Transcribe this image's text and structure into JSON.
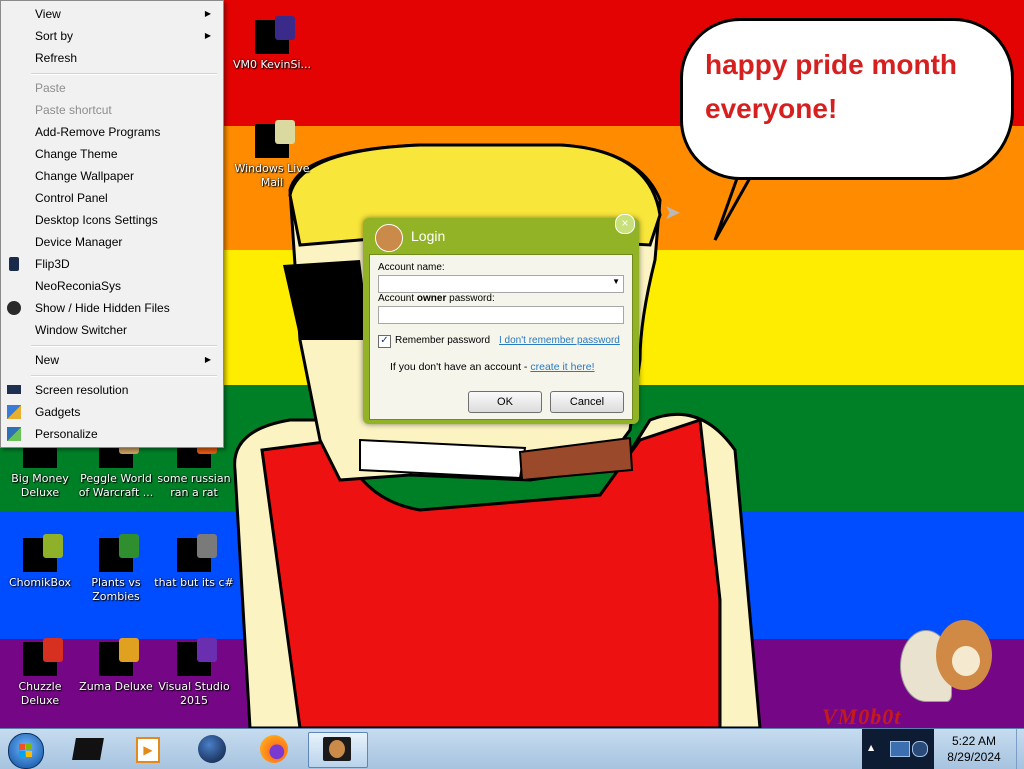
{
  "desktop": {
    "stripe_colors": [
      "#e40303",
      "#ff8c00",
      "#ffed00",
      "#008026",
      "#004dff",
      "#750787"
    ],
    "speech_bubble": "happy pride month everyone!",
    "watermark": "VM0b0t",
    "icons": [
      {
        "label": "VM0 KevinSi...",
        "icon": "video-file-icon"
      },
      {
        "label": "Windows Live Mail",
        "icon": "mail-icon"
      },
      {
        "label": "Big Money Deluxe",
        "icon": "game-icon"
      },
      {
        "label": "Peggle World of Warcraft ...",
        "icon": "game-icon"
      },
      {
        "label": "some russian ran a rat",
        "icon": "file-icon"
      },
      {
        "label": "ChomikBox",
        "icon": "hamster-app-icon"
      },
      {
        "label": "Plants vs Zombies",
        "icon": "game-icon"
      },
      {
        "label": "that but its c#",
        "icon": "file-icon"
      },
      {
        "label": "Chuzzle Deluxe",
        "icon": "game-icon"
      },
      {
        "label": "Zuma Deluxe",
        "icon": "game-icon"
      },
      {
        "label": "Visual Studio 2015",
        "icon": "visual-studio-icon"
      }
    ]
  },
  "context_menu": {
    "items": [
      {
        "label": "View",
        "submenu": true,
        "disabled": false
      },
      {
        "label": "Sort by",
        "submenu": true,
        "disabled": false
      },
      {
        "label": "Refresh",
        "submenu": false,
        "disabled": false
      },
      {
        "label": "Paste",
        "submenu": false,
        "disabled": true
      },
      {
        "label": "Paste shortcut",
        "submenu": false,
        "disabled": true
      },
      {
        "label": "Add-Remove Programs",
        "submenu": false,
        "disabled": false
      },
      {
        "label": "Change Theme",
        "submenu": false,
        "disabled": false
      },
      {
        "label": "Change Wallpaper",
        "submenu": false,
        "disabled": false
      },
      {
        "label": "Control Panel",
        "submenu": false,
        "disabled": false
      },
      {
        "label": "Desktop Icons Settings",
        "submenu": false,
        "disabled": false
      },
      {
        "label": "Device Manager",
        "submenu": false,
        "disabled": false
      },
      {
        "label": "Flip3D",
        "submenu": false,
        "disabled": false,
        "icon": "flip3d-icon"
      },
      {
        "label": "NeoReconiaSys",
        "submenu": false,
        "disabled": false
      },
      {
        "label": "Show / Hide Hidden Files",
        "submenu": false,
        "disabled": false,
        "icon": "eye-icon"
      },
      {
        "label": "Window Switcher",
        "submenu": false,
        "disabled": false
      },
      {
        "label": "New",
        "submenu": true,
        "disabled": false
      },
      {
        "label": "Screen resolution",
        "submenu": false,
        "disabled": false,
        "icon": "monitor-icon"
      },
      {
        "label": "Gadgets",
        "submenu": false,
        "disabled": false,
        "icon": "gadgets-icon"
      },
      {
        "label": "Personalize",
        "submenu": false,
        "disabled": false,
        "icon": "personalize-icon"
      }
    ]
  },
  "login_dialog": {
    "title": "Login",
    "account_name_label": "Account name:",
    "account_name_value": "",
    "password_label_prefix": "Account ",
    "password_label_bold": "owner",
    "password_label_suffix": " password:",
    "password_value": "",
    "remember_label": "Remember password",
    "remember_checked": true,
    "forgot_link": "I don't remember password",
    "signup_prefix": "If you don't have an account - ",
    "signup_link": "create it here!",
    "ok_label": "OK",
    "cancel_label": "Cancel",
    "close_label": "×"
  },
  "taskbar": {
    "start_icon": "windows-orb-icon",
    "pinned": [
      "black-box-icon",
      "media-player-icon",
      "globe-icon",
      "firefox-icon",
      "hamster-app-icon"
    ],
    "clock_time": "5:22 AM",
    "clock_date": "8/29/2024"
  }
}
